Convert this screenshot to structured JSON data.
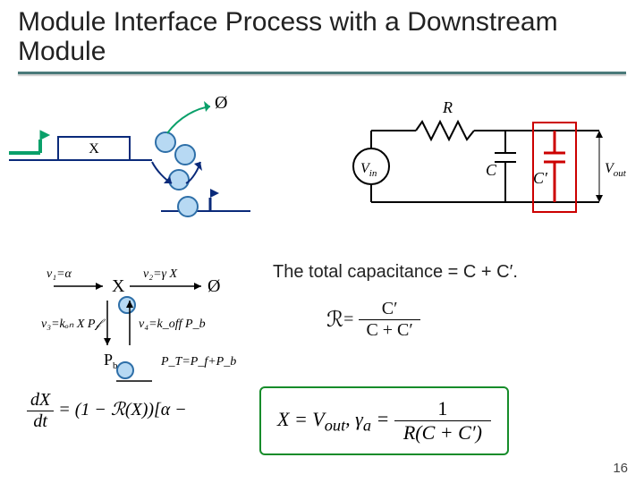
{
  "title": "Module Interface Process with a Downstream Module",
  "bio": {
    "x_label": "X",
    "phi_label": "Ø"
  },
  "circuit": {
    "R": "R",
    "Vin": "V",
    "Vin_sub": "in",
    "C": "C",
    "Cp": "C'",
    "Vout": "V",
    "Vout_sub": "out"
  },
  "reaction": {
    "v1": "v₁=α",
    "X": "X",
    "v2": "v₂=γ X",
    "phi": "Ø",
    "v3": "v₃=kₒₙ X P_f",
    "v4": "v₄=k_off P_b",
    "Pb": "P_b",
    "PT": "P_T=P_f+P_b"
  },
  "eqns": {
    "line1": "The total capacitance = C + C′.",
    "line2_lhs": "ℛ",
    "line2_eq": " = ",
    "line2_num": "C′",
    "line2_den": "C + C′"
  },
  "bottom": {
    "lhs_num": "dX",
    "lhs_den": "dt",
    "lhs_rest": " = (1 − ℛ(X))[α −",
    "rhs_x": "X = V",
    "rhs_x_sub": "out",
    "rhs_comma": ",   ",
    "rhs_g": "γ",
    "rhs_g_sub": "a",
    "rhs_eq": " = ",
    "frac_num": "1",
    "frac_den": "R(C + C′)"
  },
  "page": "16"
}
